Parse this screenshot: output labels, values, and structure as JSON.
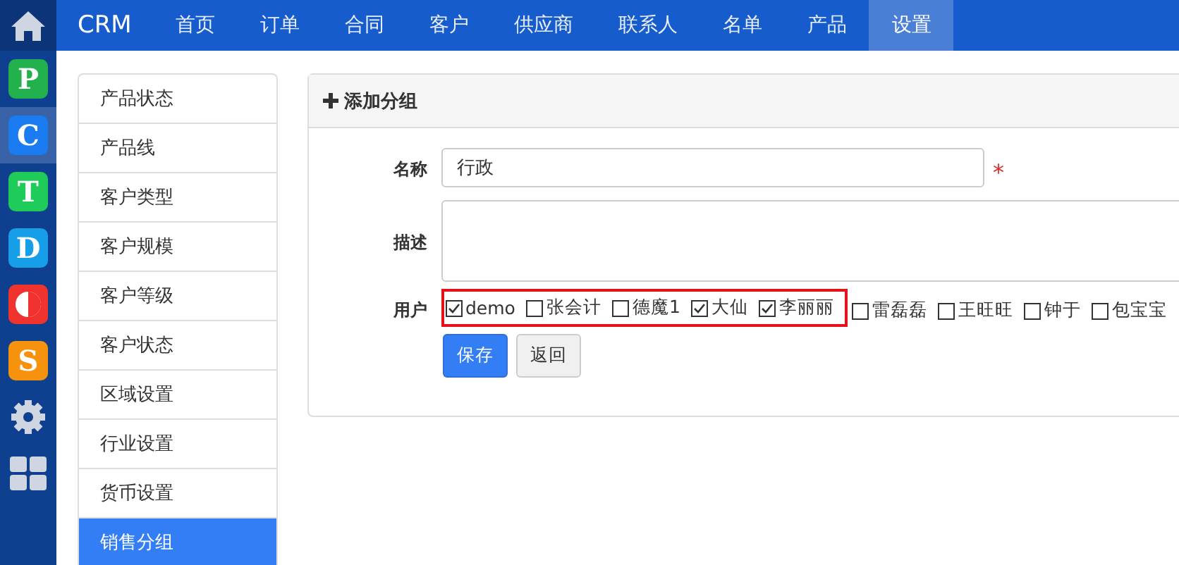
{
  "app_bar": [
    {
      "kind": "home",
      "selected": false
    },
    {
      "kind": "letter",
      "letter": "P",
      "color": "#22b14c",
      "selected": false
    },
    {
      "kind": "letter",
      "letter": "C",
      "color": "#1a7cf0",
      "selected": true
    },
    {
      "kind": "letter",
      "letter": "T",
      "color": "#1fcc5a",
      "selected": false
    },
    {
      "kind": "letter",
      "letter": "D",
      "color": "#169ee8",
      "selected": false
    },
    {
      "kind": "halfcircle",
      "color": "#f0332f",
      "selected": false
    },
    {
      "kind": "letter",
      "letter": "S",
      "color": "#f7920f",
      "selected": false
    },
    {
      "kind": "gear",
      "selected": false
    },
    {
      "kind": "grid",
      "selected": false
    }
  ],
  "brand": "CRM",
  "nav": [
    {
      "label": "首页",
      "selected": false
    },
    {
      "label": "订单",
      "selected": false
    },
    {
      "label": "合同",
      "selected": false
    },
    {
      "label": "客户",
      "selected": false
    },
    {
      "label": "供应商",
      "selected": false
    },
    {
      "label": "联系人",
      "selected": false
    },
    {
      "label": "名单",
      "selected": false
    },
    {
      "label": "产品",
      "selected": false
    },
    {
      "label": "设置",
      "selected": true
    }
  ],
  "sidebar": {
    "items": [
      {
        "label": "产品状态",
        "selected": false
      },
      {
        "label": "产品线",
        "selected": false
      },
      {
        "label": "客户类型",
        "selected": false
      },
      {
        "label": "客户规模",
        "selected": false
      },
      {
        "label": "客户等级",
        "selected": false
      },
      {
        "label": "客户状态",
        "selected": false
      },
      {
        "label": "区域设置",
        "selected": false
      },
      {
        "label": "行业设置",
        "selected": false
      },
      {
        "label": "货币设置",
        "selected": false
      },
      {
        "label": "销售分组",
        "selected": true
      }
    ]
  },
  "panel": {
    "title": "添加分组",
    "name_label": "名称",
    "name_value": "行政",
    "required_mark": "*",
    "description_label": "描述",
    "users_label": "用户",
    "users": [
      {
        "name": "demo",
        "checked": true,
        "highlighted": true
      },
      {
        "name": "张会计",
        "checked": false,
        "highlighted": true
      },
      {
        "name": "德魔1",
        "checked": false,
        "highlighted": true
      },
      {
        "name": "大仙",
        "checked": true,
        "highlighted": true
      },
      {
        "name": "李丽丽",
        "checked": true,
        "highlighted": true
      },
      {
        "name": "雷磊磊",
        "checked": false,
        "highlighted": false
      },
      {
        "name": "王旺旺",
        "checked": false,
        "highlighted": false
      },
      {
        "name": "钟于",
        "checked": false,
        "highlighted": false
      },
      {
        "name": "包宝宝",
        "checked": false,
        "highlighted": false
      }
    ],
    "buttons": [
      {
        "label": "保存",
        "kind": "primary"
      },
      {
        "label": "返回",
        "kind": "default"
      }
    ]
  }
}
